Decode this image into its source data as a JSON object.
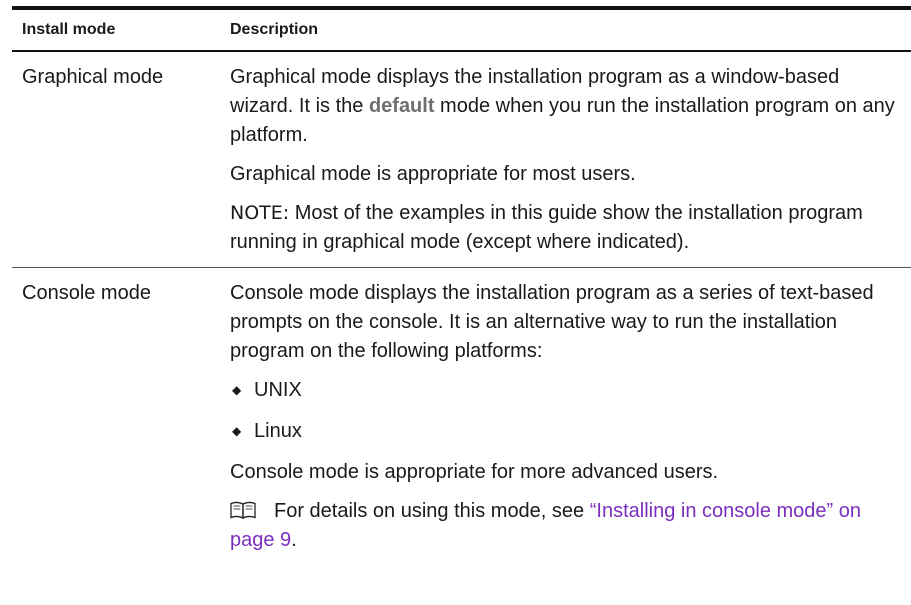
{
  "headers": {
    "mode": "Install mode",
    "description": "Description"
  },
  "rows": [
    {
      "mode": "Graphical mode",
      "p1_before": "Graphical mode displays the installation program as a window-based wizard. It is the ",
      "p1_emph": "default",
      "p1_after": " mode when you run the installation program on any platform.",
      "p2": "Graphical mode is appropriate for most users.",
      "note_label": "NOTE:",
      "note_text": "  Most of the examples in this guide show the installation program running in graphical mode (except where indicated)."
    },
    {
      "mode": "Console mode",
      "p1": "Console mode displays the installation program as a series of text-based prompts on the console. It is an alternative way to run the installation program on the following platforms:",
      "bullets": [
        "UNIX",
        "Linux"
      ],
      "p2": "Console mode is appropriate for more advanced users.",
      "ref_text": "For details on using this mode, see ",
      "ref_link": "“Installing in console mode” on page 9",
      "ref_end": "."
    }
  ],
  "icons": {
    "bullet": "diamond-bullet-icon",
    "reference": "book-icon"
  },
  "colors": {
    "link": "#7b2fbf",
    "emphasis": "#6f6f6f",
    "rule": "#111111"
  }
}
